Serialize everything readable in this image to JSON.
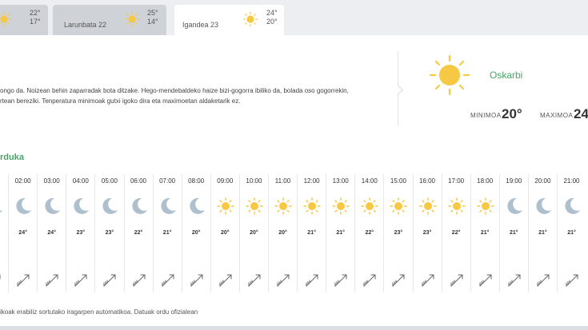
{
  "tabs": [
    {
      "label": "",
      "max": "22°",
      "min": "17°"
    },
    {
      "label": "Larunbata 22",
      "max": "25°",
      "min": "14°"
    },
    {
      "label": "Igandea 23",
      "max": "24°",
      "min": "20°",
      "active": true
    }
  ],
  "forecast": {
    "lines": [
      "ongo da. Noizean behin zaparradak bota ditzake. Hego-mendebaldeko haize bizi-gogorra ibiliko da, bolada oso gogorrekin,",
      "rtean bereziki. Tenperatura minimoak gutxi igoko dira eta maximoetan aldaketarik ez."
    ],
    "condition": "Oskarbi",
    "min_label": "MINIMOA",
    "min_value": "20°",
    "max_label": "MAXIMOA",
    "max_value": "24"
  },
  "hourly": {
    "title": "rduka",
    "items": [
      {
        "time": "",
        "icon": "moon",
        "temp": ""
      },
      {
        "time": "02:00",
        "icon": "moon",
        "temp": "24°"
      },
      {
        "time": "03:00",
        "icon": "moon",
        "temp": "24°"
      },
      {
        "time": "04:00",
        "icon": "moon",
        "temp": "23°"
      },
      {
        "time": "05:00",
        "icon": "moon",
        "temp": "23°"
      },
      {
        "time": "06:00",
        "icon": "moon",
        "temp": "22°"
      },
      {
        "time": "07:00",
        "icon": "moon",
        "temp": "21°"
      },
      {
        "time": "08:00",
        "icon": "moon",
        "temp": "20°"
      },
      {
        "time": "09:00",
        "icon": "sun",
        "temp": "20°"
      },
      {
        "time": "10:00",
        "icon": "sun",
        "temp": "20°"
      },
      {
        "time": "11:00",
        "icon": "sun",
        "temp": "20°"
      },
      {
        "time": "12:00",
        "icon": "sun",
        "temp": "21°"
      },
      {
        "time": "13:00",
        "icon": "sun",
        "temp": "21°"
      },
      {
        "time": "14:00",
        "icon": "sun",
        "temp": "22°"
      },
      {
        "time": "15:00",
        "icon": "sun",
        "temp": "23°"
      },
      {
        "time": "16:00",
        "icon": "sun",
        "temp": "23°"
      },
      {
        "time": "17:00",
        "icon": "sun",
        "temp": "22°"
      },
      {
        "time": "18:00",
        "icon": "sun",
        "temp": "21°"
      },
      {
        "time": "19:00",
        "icon": "moon",
        "temp": "21°"
      },
      {
        "time": "20:00",
        "icon": "moon",
        "temp": "21°"
      },
      {
        "time": "21:00",
        "icon": "moon",
        "temp": "21°"
      }
    ]
  },
  "footnote": "ikoak erabiliz sortutako iragarpen automatikoa. Datuak ordu ofizialean",
  "colors": {
    "accent": "#4aa36b",
    "sun": "#f6c843",
    "moon": "#aebfcd"
  }
}
